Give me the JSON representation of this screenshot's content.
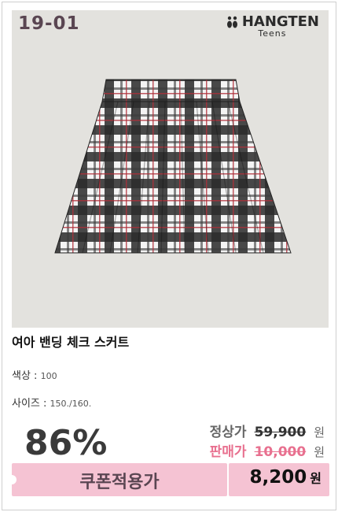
{
  "product": {
    "code": "19-01",
    "brand_name": "HANGTEN",
    "brand_sub": "Teens",
    "title": "여아 밴딩 체크 스커트",
    "color_label": "색상 :",
    "color_value": "100",
    "size_label": "사이즈 :",
    "size_value": "150./160."
  },
  "pricing": {
    "discount": "86%",
    "regular_label": "정상가",
    "regular_price": "59,900",
    "sale_label": "판매가",
    "sale_price": "10,000",
    "currency": "원",
    "coupon_label": "쿠폰적용가",
    "final_price": "8,200",
    "final_currency": "원"
  },
  "colors": {
    "regular_label": "#666666",
    "sale_label": "#e8708f",
    "coupon_bg": "#f5c3d3",
    "photo_bg": "#e3e2de"
  }
}
